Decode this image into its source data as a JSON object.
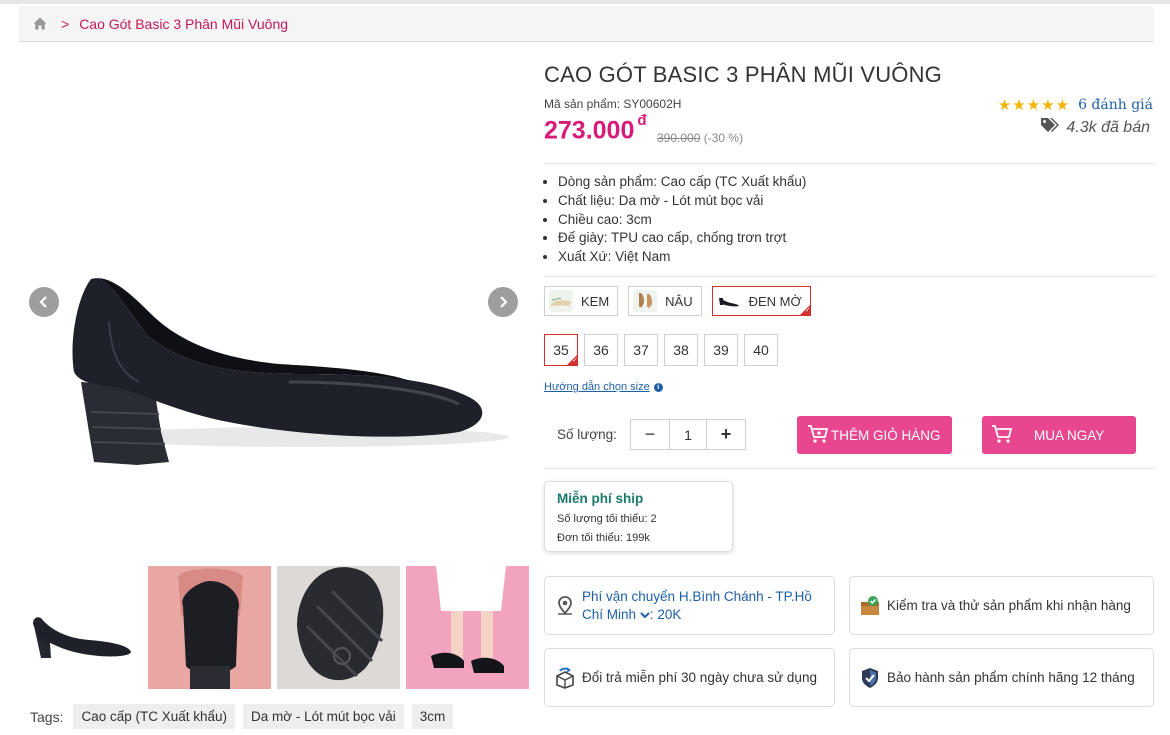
{
  "breadcrumb": {
    "home_icon": "home-icon",
    "current": "Cao Gót Basic 3 Phân Mũi Vuông"
  },
  "product": {
    "title": "CAO GÓT BASIC 3 PHÂN MŨI VUÔNG",
    "sku_label": "Mã sản phẩm: SY00602H",
    "price": "273.000",
    "currency": "đ",
    "old_price": "390.000",
    "discount": "(-30 %)",
    "rating_stars": 5,
    "stars_text": "★★★★★",
    "reviews": "6 đánh giá",
    "sold": "4.3k đã bán"
  },
  "specs": [
    "Dòng sản phẩm: Cao cấp (TC Xuất khẩu)",
    "Chất liệu: Da mờ - Lót mút bọc vải",
    "Chiều cao: 3cm",
    "Đế giày: TPU cao cấp, chống trơn trợt",
    "Xuất Xứ: Việt Nam"
  ],
  "colors": [
    {
      "label": "KEM",
      "swatch": "#e9d9c2",
      "selected": false
    },
    {
      "label": "NÂU",
      "swatch": "#b07f52",
      "selected": false
    },
    {
      "label": "ĐEN MỜ",
      "swatch": "#1b1b22",
      "selected": true
    }
  ],
  "sizes": [
    {
      "label": "35",
      "selected": true
    },
    {
      "label": "36",
      "selected": false
    },
    {
      "label": "37",
      "selected": false
    },
    {
      "label": "38",
      "selected": false
    },
    {
      "label": "39",
      "selected": false
    },
    {
      "label": "40",
      "selected": false
    }
  ],
  "size_guide": "Hướng dẫn chọn size",
  "quantity": {
    "label": "Số lượng:",
    "value": "1",
    "minus": "−",
    "plus": "+"
  },
  "actions": {
    "add_to_cart": "THÊM GIỎ HÀNG",
    "buy_now": "MUA NGAY"
  },
  "shipping_promo": {
    "title": "Miễn phí ship",
    "min_qty": "Số lượng tối thiểu: 2",
    "min_order": "Đơn tối thiểu: 199k"
  },
  "features": {
    "shipping_line1": "Phí vận chuyển H.Bình Chánh - TP.Hồ",
    "shipping_line2": "Chí Minh",
    "shipping_fee": "20K",
    "inspect": "Kiểm tra và thử sản phẩm khi nhận hàng",
    "return": "Đổi trả miễn phí 30 ngày chưa sử dụng",
    "warranty": "Bảo hành sản phẩm chính hãng 12 tháng"
  },
  "tags": {
    "label": "Tags:",
    "items": [
      "Cao cấp (TC Xuất khẩu)",
      "Da mờ - Lót mút bọc vải",
      "3cm"
    ]
  },
  "colors_theme": {
    "accent": "#d81b78",
    "button": "#e8468e",
    "link": "#1e5fa8",
    "star": "#f5b301"
  }
}
